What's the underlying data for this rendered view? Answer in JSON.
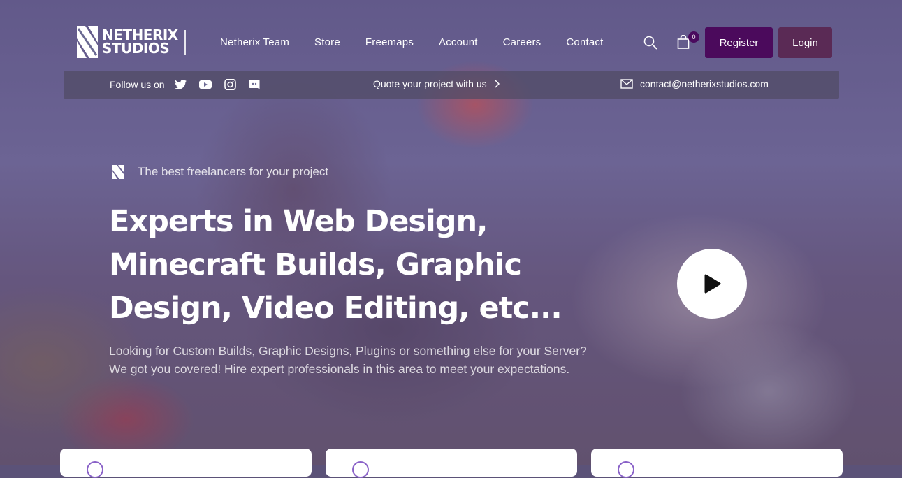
{
  "brand": {
    "name": "NETHERIX STUDIOS",
    "line1": "NETHERIX",
    "line2": "STUDIOS"
  },
  "nav": {
    "items": [
      "Netherix Team",
      "Store",
      "Freemaps",
      "Account",
      "Careers",
      "Contact"
    ],
    "cart_count": "0",
    "register_label": "Register",
    "login_label": "Login"
  },
  "infobar": {
    "follow_label": "Follow us on",
    "social": [
      "twitter-icon",
      "youtube-icon",
      "instagram-icon",
      "discord-icon"
    ],
    "quote_label": "Quote your project with us",
    "contact_email": "contact@netherixstudios.com"
  },
  "hero": {
    "tagline": "The best freelancers for your project",
    "headline": "Experts in Web Design, Minecraft Builds, Graphic Design, Video Editing, etc...",
    "subtext": "Looking for Custom Builds, Graphic Designs, Plugins or something else for your Server? We got you covered! Hire expert professionals in this area to meet your expectations."
  },
  "colors": {
    "register_bg": "#4b0a5c",
    "login_bg": "#5a2a55",
    "cart_badge": "#4a0a5e",
    "card_icon": "#8a62c8"
  }
}
